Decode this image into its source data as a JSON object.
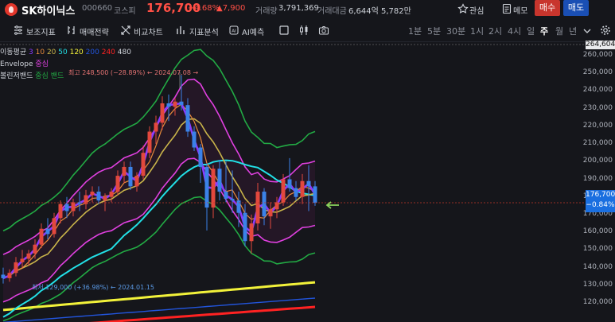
{
  "header": {
    "name": "SK하이닉스",
    "code": "000660",
    "market": "코스피",
    "price": "176,700",
    "change_pct": "+4.68%",
    "change_abs": "▲7,900",
    "volume_label": "거래량",
    "volume": "3,791,369",
    "amount_label": "거래대금",
    "amount": "6,644억 5,782만",
    "watch_label": "관심",
    "memo_label": "메모",
    "buy_label": "매수",
    "sell_label": "매도"
  },
  "toolbar": {
    "items": [
      "보조지표",
      "매매전략",
      "비교차트",
      "지표분석",
      "AI예측"
    ],
    "periods": [
      "1분",
      "5분",
      "30분",
      "1시",
      "2시",
      "4시",
      "일",
      "주",
      "월",
      "년"
    ],
    "active_period": "주"
  },
  "indicators": {
    "ma_label": "이동평균",
    "ma_periods": [
      "3",
      "10",
      "20",
      "50",
      "120",
      "200",
      "240",
      "480"
    ],
    "envelope_label": "Envelope",
    "envelope_value": "중심",
    "bb_label": "볼린저밴드",
    "bb_value": "중심 밴드"
  },
  "annotations": {
    "high": "최고 248,500 (−28.89%) ← 2024.07.08 →",
    "low": "최저 129,000 (+36.98%) ← 2024.01.15"
  },
  "axis": {
    "current_high": "264,604",
    "ticks": [
      "260,000",
      "250,000",
      "240,000",
      "230,000",
      "220,000",
      "210,000",
      "200,000",
      "190,000",
      "180,000",
      "170,000",
      "160,000",
      "150,000",
      "140,000",
      "130,000",
      "120,000"
    ],
    "last_price": "176,700",
    "last_change": "−0.84%"
  },
  "colors": {
    "up": "#e2483d",
    "down": "#3b82e8",
    "accent": "#e2362b"
  },
  "chart_data": {
    "type": "candlestick",
    "y_range": [
      112000,
      268000
    ],
    "candles": [
      [
        136000,
        140000,
        131000,
        134000
      ],
      [
        134000,
        139000,
        132000,
        137000
      ],
      [
        137000,
        146000,
        135000,
        143000
      ],
      [
        143000,
        150000,
        140000,
        145000
      ],
      [
        145000,
        150000,
        141000,
        148000
      ],
      [
        148000,
        156000,
        145000,
        153000
      ],
      [
        153000,
        165000,
        151000,
        162000
      ],
      [
        162000,
        168000,
        156000,
        159000
      ],
      [
        159000,
        171000,
        157000,
        168000
      ],
      [
        168000,
        178000,
        165000,
        176000
      ],
      [
        176000,
        180000,
        168000,
        172000
      ],
      [
        172000,
        179000,
        169000,
        177000
      ],
      [
        177000,
        183000,
        172000,
        176000
      ],
      [
        176000,
        184000,
        173000,
        181000
      ],
      [
        181000,
        186000,
        177000,
        183000
      ],
      [
        183000,
        186000,
        176000,
        178000
      ],
      [
        178000,
        182000,
        172000,
        180000
      ],
      [
        180000,
        185000,
        177000,
        183000
      ],
      [
        183000,
        195000,
        181000,
        192000
      ],
      [
        192000,
        200000,
        188000,
        197000
      ],
      [
        197000,
        200000,
        184000,
        186000
      ],
      [
        186000,
        194000,
        183000,
        192000
      ],
      [
        192000,
        209000,
        190000,
        205000
      ],
      [
        205000,
        220000,
        202000,
        217000
      ],
      [
        217000,
        226000,
        210000,
        222000
      ],
      [
        222000,
        237000,
        218000,
        233000
      ],
      [
        233000,
        238000,
        223000,
        231000
      ],
      [
        231000,
        236000,
        226000,
        234000
      ],
      [
        234000,
        249000,
        229000,
        232000
      ],
      [
        232000,
        236000,
        214000,
        217000
      ],
      [
        217000,
        220000,
        206000,
        208000
      ],
      [
        208000,
        210000,
        188000,
        197000
      ],
      [
        197000,
        199000,
        161000,
        174000
      ],
      [
        174000,
        198000,
        168000,
        196000
      ],
      [
        196000,
        201000,
        178000,
        183000
      ],
      [
        183000,
        200000,
        177000,
        179000
      ],
      [
        179000,
        195000,
        171000,
        178000
      ],
      [
        178000,
        183000,
        163000,
        171000
      ],
      [
        171000,
        176000,
        152000,
        155000
      ],
      [
        155000,
        170000,
        148000,
        165000
      ],
      [
        165000,
        188000,
        161000,
        183000
      ],
      [
        183000,
        185000,
        164000,
        169000
      ],
      [
        169000,
        177000,
        162000,
        173000
      ],
      [
        173000,
        180000,
        168000,
        177000
      ],
      [
        177000,
        193000,
        175000,
        190000
      ],
      [
        190000,
        202000,
        183000,
        185000
      ],
      [
        185000,
        189000,
        178000,
        180000
      ],
      [
        180000,
        193000,
        176000,
        189000
      ],
      [
        189000,
        198000,
        172000,
        186000
      ],
      [
        186000,
        189000,
        175000,
        176700
      ]
    ],
    "series": [
      {
        "name": "MA3",
        "color": "#8a3bff"
      },
      {
        "name": "MA10",
        "color": "#e88a3a"
      },
      {
        "name": "MA20",
        "color": "#c9b44a"
      },
      {
        "name": "MA50",
        "color": "#22e0e6"
      },
      {
        "name": "MA120",
        "color": "#f2f23a"
      },
      {
        "name": "MA200",
        "color": "#2255dd"
      },
      {
        "name": "MA240",
        "color": "#ff2222"
      },
      {
        "name": "Envelope",
        "color": "#e040e0"
      },
      {
        "name": "Bollinger",
        "color": "#22aa44"
      }
    ]
  }
}
